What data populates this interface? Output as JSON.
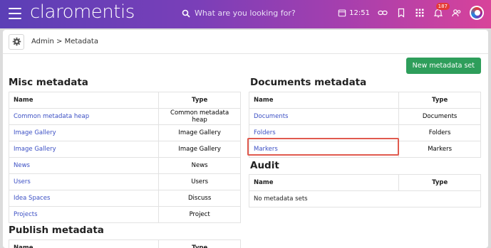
{
  "header": {
    "logo": "claromentis",
    "search_placeholder": "What are you looking for?",
    "time": "12:51",
    "notification_count": "187"
  },
  "breadcrumb": "Admin > Metadata",
  "new_button": "New metadata set",
  "misc": {
    "title": "Misc metadata",
    "col_name": "Name",
    "col_type": "Type",
    "rows": [
      {
        "name": "Common metadata heap",
        "type": "Common metadata heap"
      },
      {
        "name": "Image Gallery",
        "type": "Image Gallery"
      },
      {
        "name": "Image Gallery",
        "type": "Image Gallery"
      },
      {
        "name": "News",
        "type": "News"
      },
      {
        "name": "Users",
        "type": "Users"
      },
      {
        "name": "Idea Spaces",
        "type": "Discuss"
      },
      {
        "name": "Projects",
        "type": "Project"
      }
    ]
  },
  "publish": {
    "title": "Publish metadata",
    "col_name": "Name",
    "col_type": "Type"
  },
  "documents": {
    "title": "Documents metadata",
    "col_name": "Name",
    "col_type": "Type",
    "rows": [
      {
        "name": "Documents",
        "type": "Documents"
      },
      {
        "name": "Folders",
        "type": "Folders"
      },
      {
        "name": "Markers",
        "type": "Markers"
      }
    ]
  },
  "audit": {
    "title": "Audit",
    "col_name": "Name",
    "col_type": "Type",
    "empty": "No metadata sets"
  },
  "colors": {
    "accent_green": "#2e9e5b",
    "link": "#3b4fc4",
    "highlight": "#e05a4e"
  }
}
